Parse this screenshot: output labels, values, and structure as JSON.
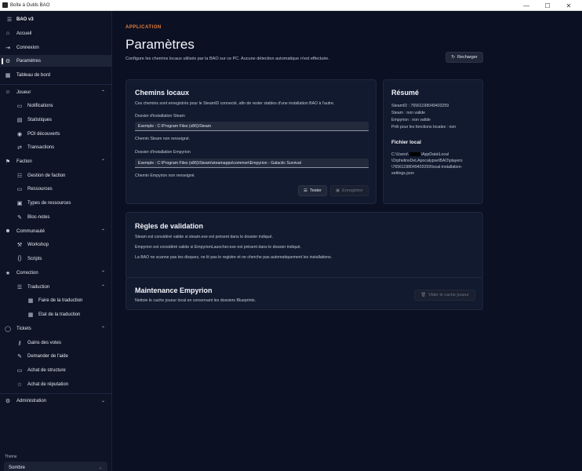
{
  "window": {
    "title": "Boîte à Outils BAO",
    "controls": [
      "—",
      "☐",
      "✕"
    ]
  },
  "sidebar": {
    "brand": "BAO v3",
    "items": [
      {
        "label": "Accueil"
      },
      {
        "label": "Connexion"
      },
      {
        "label": "Paramètres",
        "active": true
      },
      {
        "label": "Tableau de bord"
      },
      {
        "label": "Joueur"
      },
      {
        "label": "Notifications"
      },
      {
        "label": "Statistiques"
      },
      {
        "label": "POI découverts"
      },
      {
        "label": "Transactions"
      },
      {
        "label": "Faction"
      },
      {
        "label": "Gestion de faction"
      },
      {
        "label": "Ressources"
      },
      {
        "label": "Types de ressources"
      },
      {
        "label": "Bloc-notes"
      },
      {
        "label": "Communauté"
      },
      {
        "label": "Workshop"
      },
      {
        "label": "Scripts"
      },
      {
        "label": "Correction"
      },
      {
        "label": "Traduction"
      },
      {
        "label": "Faire de la traduction"
      },
      {
        "label": "Etat de la traduction"
      },
      {
        "label": "Tickets"
      },
      {
        "label": "Gains des votes"
      },
      {
        "label": "Demander de l'aide"
      },
      {
        "label": "Achat de structure"
      },
      {
        "label": "Achat de réputation"
      },
      {
        "label": "Administration"
      }
    ],
    "theme_label": "Thème",
    "theme_value": "Sombre"
  },
  "header": {
    "eyebrow": "APPLICATION",
    "title": "Paramètres",
    "subtitle": "Configure les chemins locaux utilisés par la BAO sur ce PC. Aucune détection automatique n'est effectuée.",
    "reload_label": "Recharger"
  },
  "local_paths": {
    "title": "Chemins locaux",
    "description": "Ces chemins sont enregistrés pour le SteamID connecté, afin de rester stables d'une installation BAO à l'autre.",
    "steam_label": "Dossier d'installation Steam",
    "steam_placeholder": "Exemple : C:\\Program Files (x86)\\Steam",
    "steam_status": "Chemin Steam non renseigné.",
    "empyrion_label": "Dossier d'installation Empyrion",
    "empyrion_placeholder": "Exemple : C:\\Program Files (x86)\\Steam\\steamapps\\common\\Empyrion - Galactic Survival",
    "empyrion_status": "Chemin Empyrion non renseigné.",
    "test_label": "Tester",
    "save_label": "Enregistrer"
  },
  "summary": {
    "title": "Résumé",
    "steamid": "SteamID : 76561198049403259",
    "steam": "Steam : non valide",
    "empyrion": "Empyrion : non valide",
    "ready": "Prêt pour les fonctions locales : non",
    "local_file_title": "Fichier local",
    "path_line1_a": "C:\\Users\\",
    "path_line1_b": "\\AppData\\Local",
    "path_line2": "\\OrphelinsDeLApocalypse\\BAO\\players",
    "path_line3": "\\76561198049403259\\local-installation-",
    "path_line4": "settings.json"
  },
  "validation": {
    "title": "Règles de validation",
    "rule1": "Steam est considéré valide si steam.exe est présent dans le dossier indiqué.",
    "rule2": "Empyrion est considéré valide si EmpyrionLauncher.exe est présent dans le dossier indiqué.",
    "rule3": "La BAO ne scanne pas tes disques, ne lit pas le registre et ne cherche pas automatiquement les installations."
  },
  "maintenance": {
    "title": "Maintenance Empyrion",
    "description": "Nettoie le cache joueur local en conservant les dossiers Blueprints.",
    "clear_label": "Vider le cache joueur"
  }
}
